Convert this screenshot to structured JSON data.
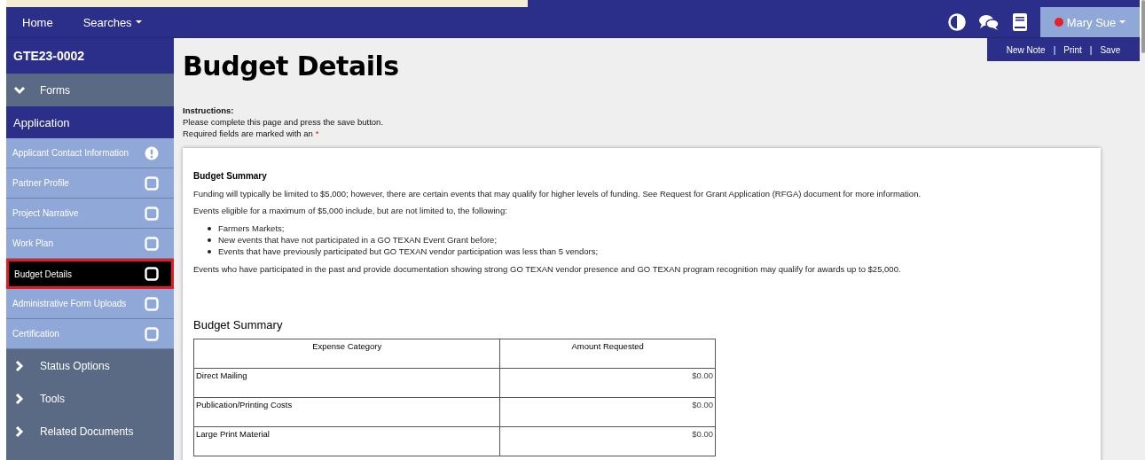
{
  "top_nav": {
    "links": [
      {
        "label": "Home",
        "dropdown": false
      },
      {
        "label": "Searches",
        "dropdown": true
      }
    ],
    "user": {
      "name": "Mary Sue",
      "dropdown": true
    },
    "actions": [
      "New Note",
      "Print",
      "Save"
    ],
    "separator": "|"
  },
  "sidebar": {
    "record": "GTE23-0002",
    "sections": [
      {
        "label": "Forms",
        "expanded": true,
        "groups": [
          {
            "label": "Application",
            "items": [
              {
                "label": "Applicant Contact Information",
                "kind": "warning",
                "selected": false
              },
              {
                "label": "Partner Profile",
                "kind": "incomplete",
                "selected": false
              },
              {
                "label": "Project Narrative",
                "kind": "incomplete",
                "selected": false
              },
              {
                "label": "Work Plan",
                "kind": "incomplete",
                "selected": false
              },
              {
                "label": "Budget Details",
                "kind": "incomplete",
                "selected": true
              },
              {
                "label": "Administrative Form Uploads",
                "kind": "incomplete",
                "selected": false
              },
              {
                "label": "Certification",
                "kind": "incomplete",
                "selected": false
              }
            ]
          }
        ]
      },
      {
        "label": "Status Options",
        "expanded": false
      },
      {
        "label": "Tools",
        "expanded": false
      },
      {
        "label": "Related Documents",
        "expanded": false
      }
    ]
  },
  "main": {
    "title": "Budget Details",
    "instructions": {
      "label": "Instructions:",
      "lines": [
        "Please complete this page and press the save button.",
        "Required fields are marked with an"
      ],
      "required_mark": "*"
    },
    "card": {
      "heading": "Budget Summary",
      "paragraphs": [
        "Funding will typically be limited to $5,000; however, there are certain events that may qualify for higher levels of funding. See Request for Grant Application (RFGA) document for more information.",
        "Events eligible for a maximum of $5,000 include, but are not limited to, the following:"
      ],
      "bullets": [
        "Farmers Markets;",
        "New events that have not participated in a GO TEXAN Event Grant before;",
        "Events that have previously participated but GO TEXAN vendor participation was less than 5 vendors;"
      ],
      "closing": "Events who have participated in the past and provide documentation showing strong GO TEXAN vendor presence and GO TEXAN program recognition may qualify for awards up to $25,000.",
      "table": {
        "title": "Budget Summary",
        "columns": [
          "Expense Category",
          "Amount Requested"
        ],
        "rows": [
          [
            "Direct Mailing",
            "$0.00"
          ],
          [
            "Publication/Printing Costs",
            "$0.00"
          ],
          [
            "Large Print Material",
            "$0.00"
          ]
        ]
      }
    }
  }
}
